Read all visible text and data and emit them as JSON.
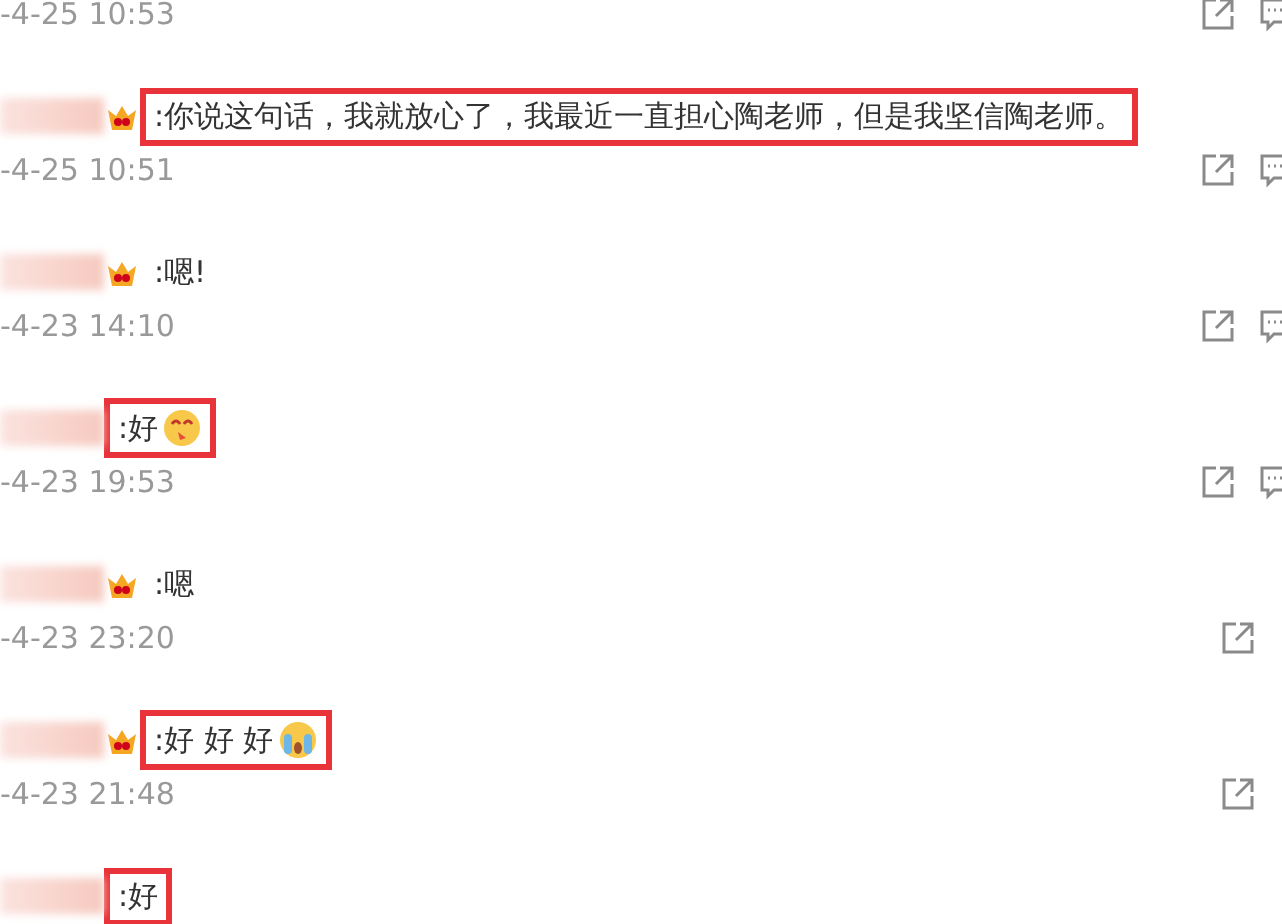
{
  "top_timestamp": "-4-25 10:53",
  "top_reply": true,
  "comments": [
    {
      "badge": true,
      "text": ":你说这句话，我就放心了，我最近一直担心陶老师，但是我坚信陶老师。",
      "highlighted": true,
      "timestamp": "-4-25 10:51",
      "reply": true
    },
    {
      "badge": true,
      "text": ":嗯!",
      "highlighted": false,
      "timestamp": "-4-23 14:10",
      "reply": true
    },
    {
      "badge": false,
      "text": ":好",
      "emoji": {
        "kind": "kiss"
      },
      "highlighted": true,
      "timestamp": "-4-23 19:53",
      "reply": true
    },
    {
      "badge": true,
      "text": ":嗯",
      "highlighted": false,
      "timestamp": "-4-23 23:20",
      "reply": false
    },
    {
      "badge": true,
      "text": ":好 好 好",
      "emoji": {
        "kind": "cry"
      },
      "highlighted": true,
      "timestamp": "-4-23 21:48",
      "reply": false
    },
    {
      "badge": false,
      "text": ":好",
      "highlighted": true
    }
  ]
}
